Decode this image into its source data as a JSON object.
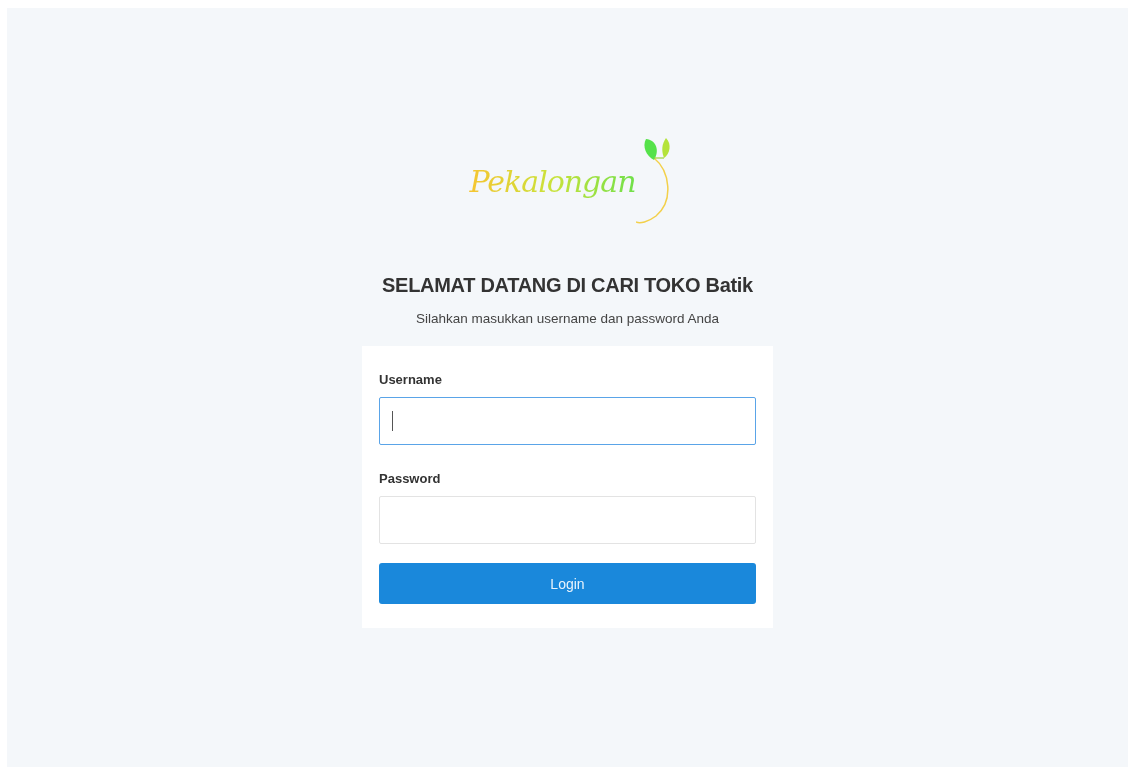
{
  "logo": {
    "text": "Pekalongan"
  },
  "title": "SELAMAT DATANG DI CARI TOKO Batik",
  "subtitle": "Silahkan masukkan username dan password Anda",
  "form": {
    "fields": [
      {
        "label": "Username",
        "focused": true
      },
      {
        "label": "Password",
        "focused": false
      }
    ],
    "submit": "Login"
  }
}
